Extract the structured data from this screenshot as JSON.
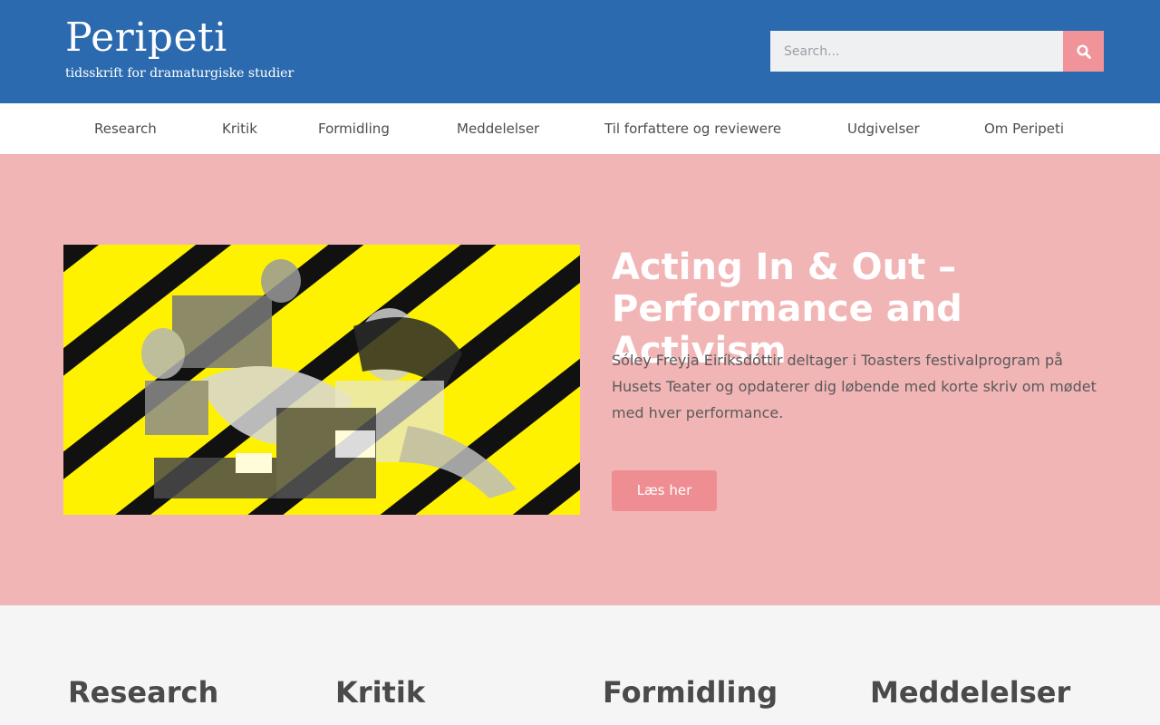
{
  "header": {
    "logo_title": "Peripeti",
    "logo_subtitle": "tidsskrift for dramaturgiske studier",
    "search_placeholder": "Search...",
    "search_icon": "search-icon",
    "colors": {
      "header_bg": "#2b6aae",
      "accent": "#f0949a"
    }
  },
  "nav": {
    "items": [
      {
        "label": "Research"
      },
      {
        "label": "Kritik"
      },
      {
        "label": "Formidling"
      },
      {
        "label": "Meddelelser"
      },
      {
        "label": "Til forfattere og reviewere"
      },
      {
        "label": "Udgivelser"
      },
      {
        "label": "Om Peripeti"
      }
    ]
  },
  "hero": {
    "title": "Acting In & Out – Performance and Activism",
    "text": "Sóley Freyja Eiríksdóttir deltager i Toasters festivalprogram på Husets Teater og opdaterer dig løbende med korte skriv om mødet med hver performance.",
    "button_label": "Læs her",
    "colors": {
      "hero_bg": "#f2b5b6",
      "button_bg": "#ef8e92"
    }
  },
  "sections": {
    "headings": [
      {
        "label": "Research"
      },
      {
        "label": "Kritik"
      },
      {
        "label": "Formidling"
      },
      {
        "label": "Meddelelser"
      }
    ]
  }
}
